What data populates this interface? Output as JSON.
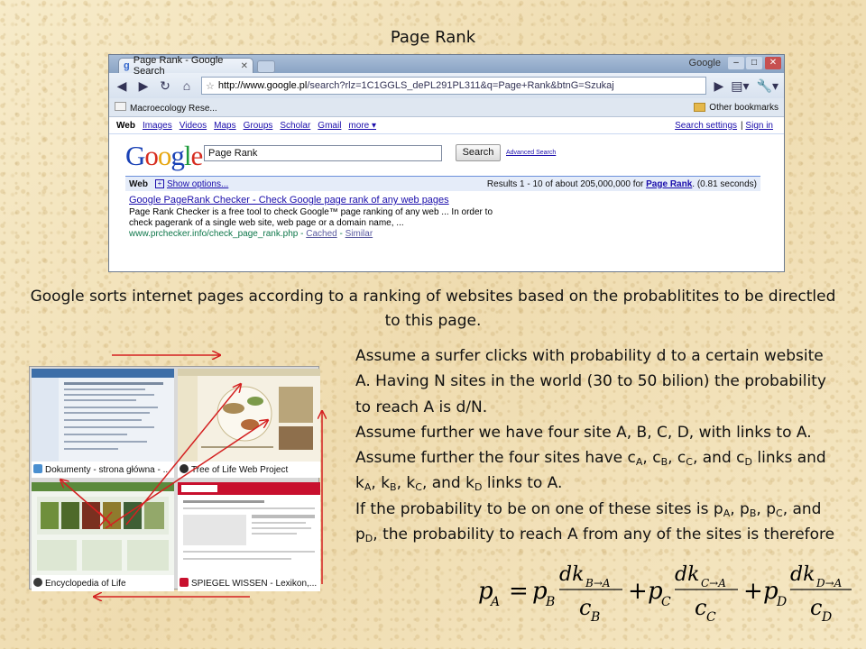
{
  "slide": {
    "title": "Page Rank",
    "caption": "Google sorts internet pages according to a ranking of websites based on the probablitites to be directled to this page.",
    "paragraph1": "Assume a surfer clicks with probability d to a certain website A. Having N sites in the world (30 to 50 bilion) the probability to reach A is d/N.",
    "p2": {
      "a": "Assume further we have four site A, B, C, D, with links to A. Assume further the four sites have c",
      "sub_a1": "A",
      "b": ", c",
      "sub_b1": "B",
      "c": ", c",
      "sub_c1": "C",
      "d": ", and c",
      "sub_d1": "D",
      "e": " links and k",
      "sub_a2": "A",
      "f": ", k",
      "sub_b2": "B",
      "g": ", k",
      "sub_c2": "C",
      "h": ", and k",
      "sub_d2": "D",
      "i": " links to A."
    },
    "p3": {
      "a": "If the probability to be on one of these sites is p",
      "sub_a": "A",
      "b": ", p",
      "sub_b": "B",
      "c": ", p",
      "sub_c": "C",
      "d": ", and p",
      "sub_d": "D",
      "e": ", the probability to reach A from any of the sites is therefore"
    },
    "formula": {
      "lhs": "p",
      "lhs_sub": "A",
      "terms": [
        {
          "p": "p",
          "p_sub": "B",
          "num": "dk",
          "num_sub": "B→A",
          "den": "c",
          "den_sub": "B"
        },
        {
          "p": "p",
          "p_sub": "C",
          "num": "dk",
          "num_sub": "C→A",
          "den": "c",
          "den_sub": "C"
        },
        {
          "p": "p",
          "p_sub": "D",
          "num": "dk",
          "num_sub": "D→A",
          "den": "c",
          "den_sub": "D"
        }
      ]
    },
    "arrow_color": "#d42020"
  },
  "browser": {
    "tab_title": "Page Rank - Google Search",
    "window_label": "Google",
    "url_host": "http://www.google.pl",
    "url_path": "/search?rlz=1C1GGLS_dePL291PL311&q=Page+Rank&btnG=Szukaj",
    "bookmark_left": "Macroecology Rese...",
    "bookmark_right": "Other bookmarks",
    "nav_links": [
      "Web",
      "Images",
      "Videos",
      "Maps",
      "Groups",
      "Scholar",
      "Gmail",
      "more ▾"
    ],
    "search_settings": "Search settings",
    "sign_in": "Sign in",
    "logo_letters": [
      "G",
      "o",
      "o",
      "g",
      "l",
      "e"
    ],
    "query": "Page Rank",
    "search_button": "Search",
    "advanced_search": "Advanced Search",
    "results_web": "Web",
    "show_options": "Show options...",
    "results_prefix": "Results 1 - 10 of about 205,000,000 for ",
    "results_query": "Page Rank",
    "results_suffix": ". (0.81 seconds)",
    "result": {
      "title": "Google PageRank Checker - Check Google page rank of any web pages",
      "snippet1": "Page Rank Checker is a free tool to check Google™ page ranking of any web ... In order to",
      "snippet2": "check pagerank of a single web site, web page or a domain name, ...",
      "url": "www.prchecker.info/check_page_rank.php",
      "cached": "Cached",
      "similar": "Similar"
    }
  },
  "collage": {
    "tiles": [
      {
        "caption": "Dokumenty - strona główna - ..."
      },
      {
        "caption": "Tree of Life Web Project"
      },
      {
        "caption": "Encyclopedia of Life"
      },
      {
        "caption": "SPIEGEL WISSEN - Lexikon,..."
      }
    ]
  }
}
